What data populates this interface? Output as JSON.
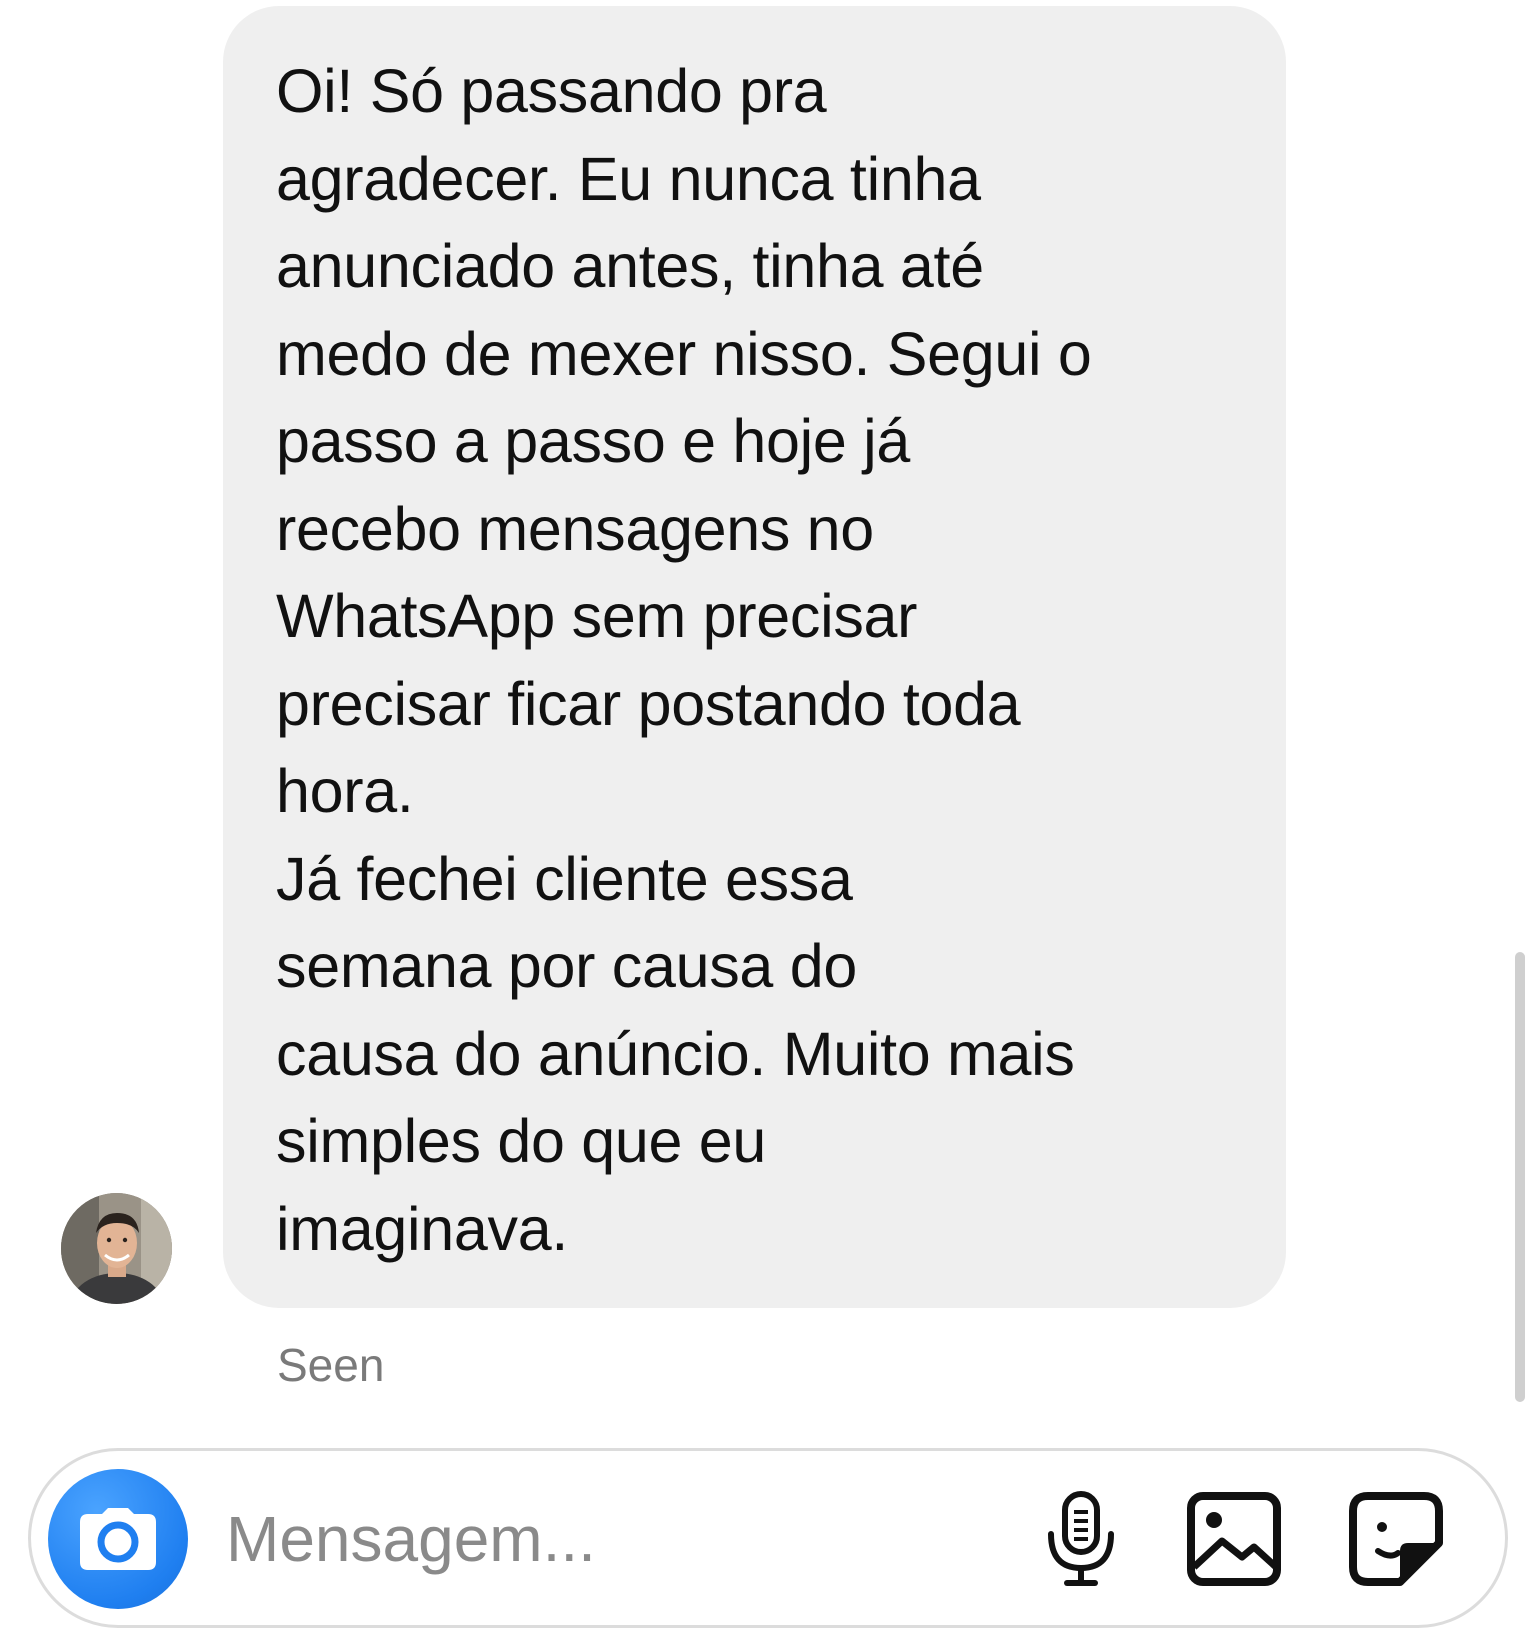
{
  "conversation": {
    "message": {
      "text": "Oi! Só passando pra\nagradecer. Eu nunca tinha\nanunciado antes, tinha até\nmedo de mexer nisso. Segui o\npasso a passo e hoje já\nrecebo mensagens no\nWhatsApp sem precisar\nprecisar ficar postando toda\nhora.\nJá fechei cliente essa\nsemana por causa do\ncausa do anúncio. Muito mais\nsimples do que eu\nimaginava."
    },
    "status": "Seen"
  },
  "composer": {
    "placeholder": "Mensagem...",
    "camera_icon": "camera-icon",
    "mic_icon": "microphone-icon",
    "gallery_icon": "image-icon",
    "sticker_icon": "sticker-icon",
    "accent_color": "#1f7ff0"
  }
}
